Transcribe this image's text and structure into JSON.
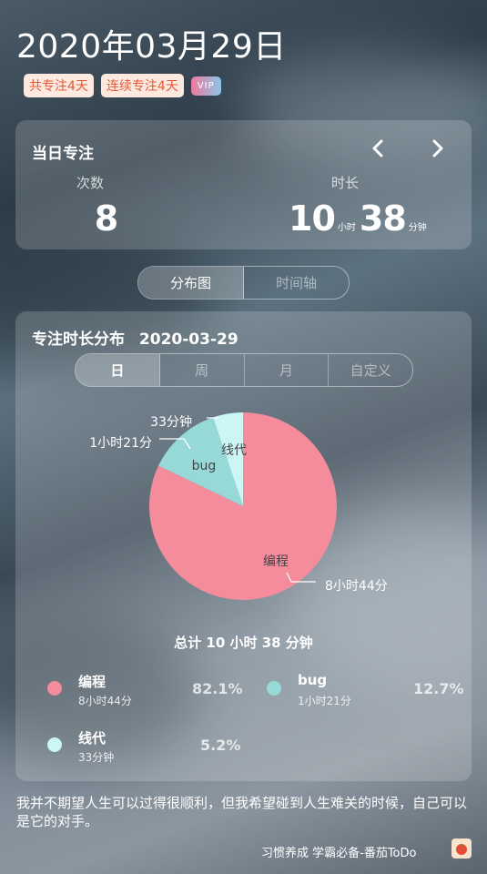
{
  "header": {
    "date": "2020年03月29日",
    "badges": [
      "共专注4天",
      "连续专注4天"
    ],
    "vip_label": "VIP"
  },
  "daily": {
    "title": "当日专注",
    "count_label": "次数",
    "count_value": "8",
    "duration_label": "时长",
    "hours": "10",
    "hours_unit": "小时",
    "minutes": "38",
    "minutes_unit": "分钟",
    "prev_icon": "chevron-left-icon",
    "next_icon": "chevron-right-icon"
  },
  "view_tabs": [
    "分布图",
    "时间轴"
  ],
  "distribution": {
    "title": "专注时长分布",
    "date": "2020-03-29",
    "range_tabs": [
      "日",
      "周",
      "月",
      "自定义"
    ],
    "total": "总计 10 小时 38 分钟"
  },
  "chart_data": {
    "type": "pie",
    "title": "",
    "slices": [
      {
        "name": "编程",
        "label": "8小时44分",
        "percent": "82.1%",
        "value": 82.1,
        "color": "#f48c9c"
      },
      {
        "name": "bug",
        "label": "1小时21分",
        "percent": "12.7%",
        "value": 12.7,
        "color": "#97d9d6"
      },
      {
        "name": "线代",
        "label": "33分钟",
        "percent": "5.2%",
        "value": 5.2,
        "color": "#ccf5f5"
      }
    ]
  },
  "quote": "我并不期望人生可以过得很顺利，但我希望碰到人生难关的时候，自己可以是它的对手。",
  "footer": "习惯养成 学霸必备-番茄ToDo",
  "app_icon": "tomato-icon"
}
